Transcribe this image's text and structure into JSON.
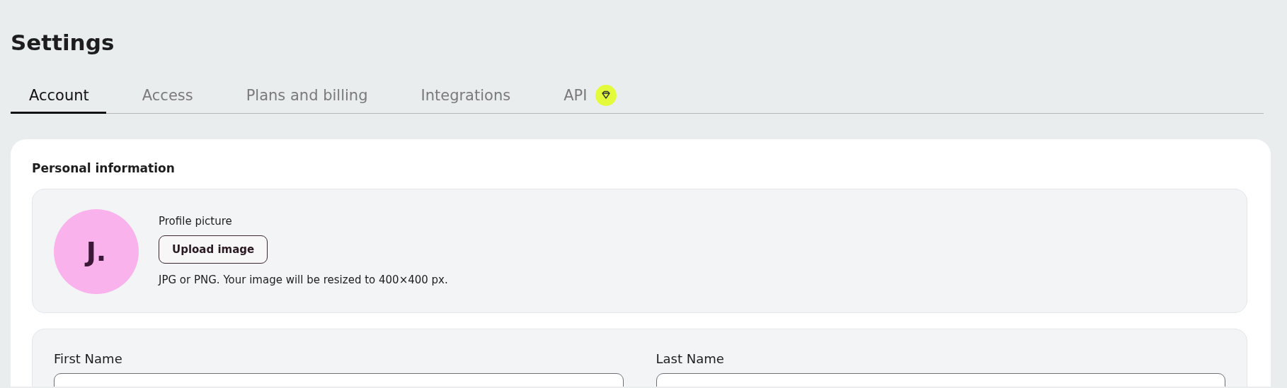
{
  "page": {
    "title": "Settings"
  },
  "tabs": [
    {
      "label": "Account",
      "selected": true
    },
    {
      "label": "Access",
      "selected": false
    },
    {
      "label": "Plans and billing",
      "selected": false
    },
    {
      "label": "Integrations",
      "selected": false
    },
    {
      "label": "API",
      "selected": false,
      "badge": true
    }
  ],
  "section": {
    "title": "Personal information"
  },
  "profile": {
    "initials": "J.",
    "label": "Profile picture",
    "button": "Upload image",
    "hint": "JPG or PNG. Your image will be resized to 400×400 px."
  },
  "fields": [
    {
      "label": "First Name"
    },
    {
      "label": "Last Name"
    }
  ]
}
